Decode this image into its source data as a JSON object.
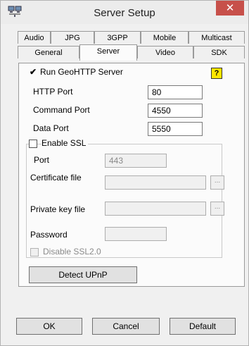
{
  "window": {
    "title": "Server Setup",
    "app_icon": "network-computers-icon",
    "close_glyph": "✕"
  },
  "tabs": {
    "row1": [
      "Audio",
      "JPG",
      "3GPP",
      "Mobile",
      "Multicast"
    ],
    "row2": [
      "General",
      "Server",
      "Video",
      "SDK"
    ],
    "active": "Server"
  },
  "server": {
    "run_label": "Run GeoHTTP Server",
    "run_checked": true,
    "help_glyph": "?",
    "http_port_label": "HTTP Port",
    "http_port_value": "80",
    "command_port_label": "Command Port",
    "command_port_value": "4550",
    "data_port_label": "Data Port",
    "data_port_value": "5550"
  },
  "ssl": {
    "enable_label": "Enable SSL",
    "enable_checked": false,
    "port_label": "Port",
    "port_value": "443",
    "cert_label": "Certificate file",
    "cert_value": "",
    "key_label": "Private key file",
    "key_value": "",
    "password_label": "Password",
    "password_value": "",
    "browse_glyph": "...",
    "disable_ssl2_label": "Disable SSL2.0",
    "disable_ssl2_checked": false
  },
  "detect_upnp_label": "Detect UPnP",
  "footer": {
    "ok_label": "OK",
    "cancel_label": "Cancel",
    "default_label": "Default"
  },
  "colors": {
    "close_button": "#c7504a",
    "help_icon": "#ffe600",
    "window_bg": "#f0f0f0",
    "panel_bg": "#fbfbfb"
  }
}
